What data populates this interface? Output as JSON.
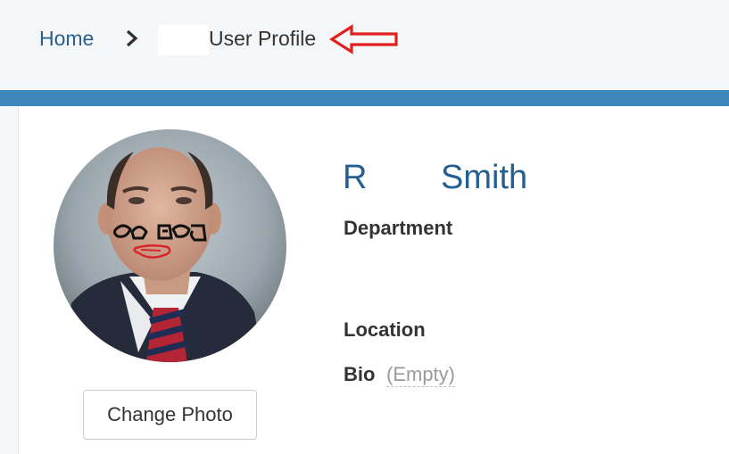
{
  "breadcrumb": {
    "home_label": "Home",
    "separator_icon": "chevron-right-icon",
    "current_label": "User Profile"
  },
  "annotation": {
    "arrow_icon": "red-outline-arrow-left-icon",
    "color": "#e0201e"
  },
  "profile": {
    "first_name": "R",
    "last_name": "Smith",
    "photo_button_label": "Change Photo",
    "fields": {
      "department_label": "Department",
      "location_label": "Location",
      "bio_label": "Bio",
      "bio_value": "(Empty)"
    }
  },
  "colors": {
    "accent": "#3f86bd",
    "name": "#245f93",
    "link": "#2b5f8e",
    "page_bg": "#f4f6f8"
  }
}
